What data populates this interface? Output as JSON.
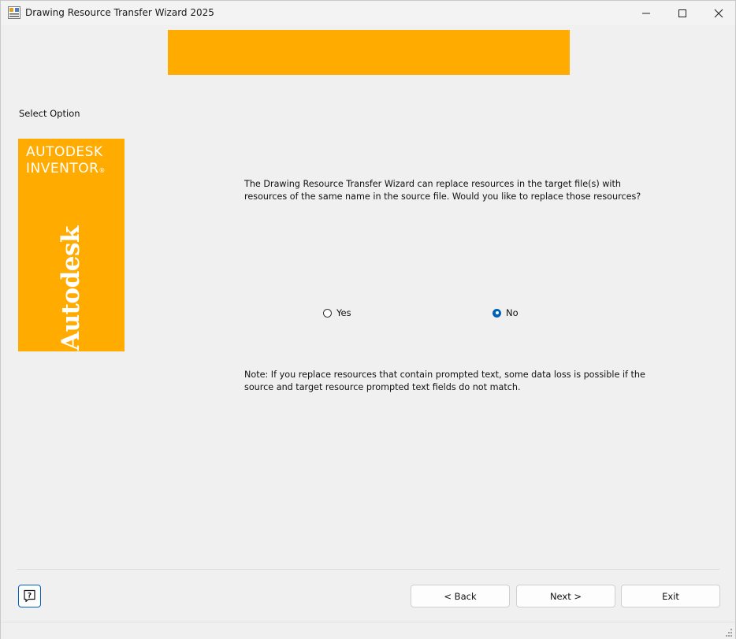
{
  "window": {
    "title": "Drawing Resource Transfer Wizard 2025"
  },
  "icons": {
    "app": "wizard-app-icon",
    "minimize": "minimize-icon",
    "maximize": "maximize-icon",
    "close": "close-icon",
    "help": "help-icon"
  },
  "colors": {
    "brand": "#ffab00",
    "radio_selected": "#005fb8",
    "help_border": "#0060c0"
  },
  "page": {
    "section_label": "Select Option",
    "description": "The Drawing Resource Transfer Wizard can replace resources in the target file(s) with resources of the same name in the source file. Would you like to replace those resources?",
    "note": "Note: If you replace resources that contain prompted text, some data loss is possible if the source and target resource prompted text fields do not match."
  },
  "logo": {
    "line1": "AUTODESK",
    "line2": "INVENTOR",
    "registered": "®",
    "wordmark": "Autodesk"
  },
  "options": {
    "yes_label": "Yes",
    "no_label": "No",
    "selected": "No"
  },
  "buttons": {
    "back": "< Back",
    "next": "Next >",
    "exit": "Exit"
  }
}
